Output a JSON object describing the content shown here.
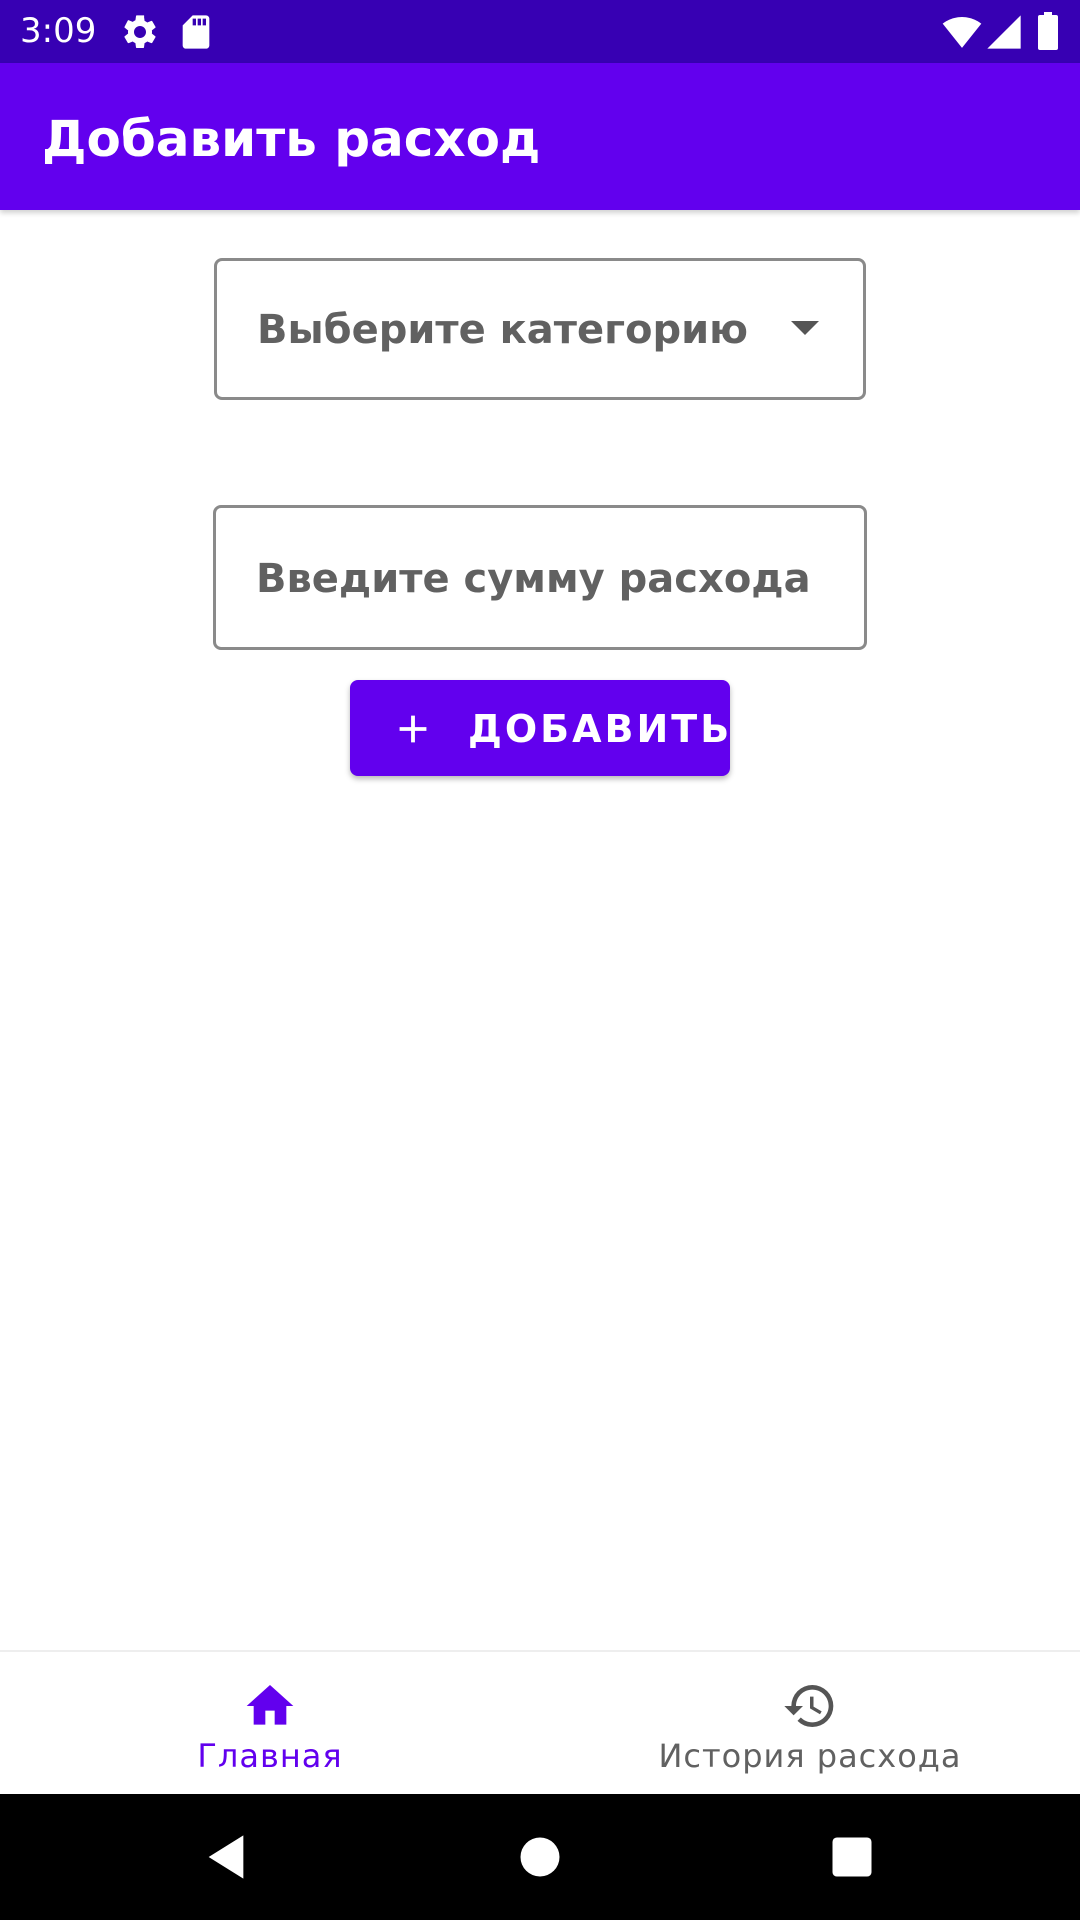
{
  "status_bar": {
    "time": "3:09",
    "icons": [
      "gear-icon",
      "sd-card-icon",
      "wifi-icon",
      "signal-icon",
      "battery-icon"
    ]
  },
  "app_bar": {
    "title": "Добавить расход"
  },
  "form": {
    "category_select": {
      "selected": "Выберите категорию"
    },
    "amount_input": {
      "placeholder": "Введите сумму расхода",
      "value": ""
    },
    "add_button": {
      "label": "ДОБАВИТЬ",
      "icon": "plus-icon"
    }
  },
  "bottom_nav": {
    "items": [
      {
        "label": "Главная",
        "icon": "home-icon",
        "active": true
      },
      {
        "label": "История расхода",
        "icon": "history-icon",
        "active": false
      }
    ]
  },
  "system_nav": {
    "buttons": [
      "back-icon",
      "home-circle-icon",
      "recents-icon"
    ]
  },
  "colors": {
    "status_bar": "#3700b3",
    "primary": "#6200ee",
    "text_secondary": "#616161",
    "outline": "#8a8a8a"
  }
}
